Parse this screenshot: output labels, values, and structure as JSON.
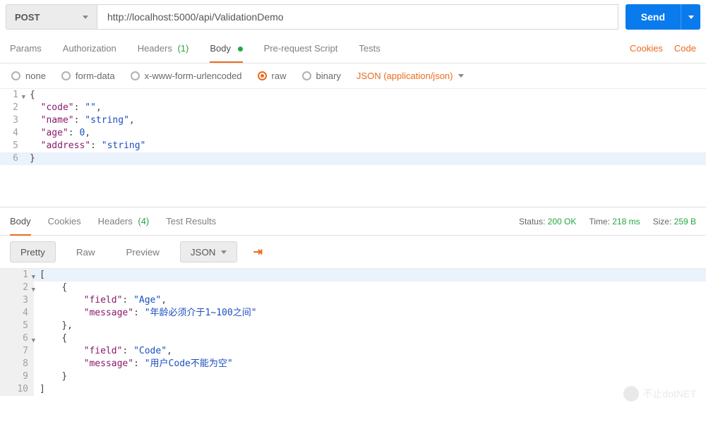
{
  "request": {
    "method": "POST",
    "url": "http://localhost:5000/api/ValidationDemo",
    "send_label": "Send"
  },
  "tabs": {
    "params": "Params",
    "authorization": "Authorization",
    "headers": "Headers",
    "headers_count": "(1)",
    "body": "Body",
    "prerequest": "Pre-request Script",
    "tests": "Tests",
    "cookies_link": "Cookies",
    "code_link": "Code"
  },
  "body_types": {
    "none": "none",
    "form_data": "form-data",
    "urlencoded": "x-www-form-urlencoded",
    "raw": "raw",
    "binary": "binary",
    "content_type": "JSON (application/json)"
  },
  "request_body_lines": [
    {
      "n": "1",
      "html": "<span class='tok-brace'>{</span>",
      "fold": true
    },
    {
      "n": "2",
      "html": "  <span class='tok-key'>\"code\"</span><span class='tok-punct'>: </span><span class='tok-str'>\"\"</span><span class='tok-punct'>,</span>"
    },
    {
      "n": "3",
      "html": "  <span class='tok-key'>\"name\"</span><span class='tok-punct'>: </span><span class='tok-str'>\"string\"</span><span class='tok-punct'>,</span>"
    },
    {
      "n": "4",
      "html": "  <span class='tok-key'>\"age\"</span><span class='tok-punct'>: </span><span class='tok-num'>0</span><span class='tok-punct'>,</span>"
    },
    {
      "n": "5",
      "html": "  <span class='tok-key'>\"address\"</span><span class='tok-punct'>: </span><span class='tok-str'>\"string\"</span>"
    },
    {
      "n": "6",
      "html": "<span class='tok-brace'>}</span>",
      "hl": true
    }
  ],
  "response_tabs": {
    "body": "Body",
    "cookies": "Cookies",
    "headers": "Headers",
    "headers_count": "(4)",
    "test_results": "Test Results"
  },
  "response_meta": {
    "status_label": "Status:",
    "status_value": "200 OK",
    "time_label": "Time:",
    "time_value": "218 ms",
    "size_label": "Size:",
    "size_value": "259 B"
  },
  "response_toolbar": {
    "pretty": "Pretty",
    "raw": "Raw",
    "preview": "Preview",
    "format": "JSON"
  },
  "response_body_lines": [
    {
      "n": "1",
      "html": "<span class='tok-brace'>[</span>",
      "fold": true,
      "hl": true
    },
    {
      "n": "2",
      "html": "    <span class='tok-brace'>{</span>",
      "fold": true
    },
    {
      "n": "3",
      "html": "        <span class='tok-key'>\"field\"</span><span class='tok-punct'>: </span><span class='tok-str'>\"Age\"</span><span class='tok-punct'>,</span>"
    },
    {
      "n": "4",
      "html": "        <span class='tok-key'>\"message\"</span><span class='tok-punct'>: </span><span class='tok-str'>\"年龄必须介于1~100之间\"</span>"
    },
    {
      "n": "5",
      "html": "    <span class='tok-brace'>}</span><span class='tok-punct'>,</span>"
    },
    {
      "n": "6",
      "html": "    <span class='tok-brace'>{</span>",
      "fold": true
    },
    {
      "n": "7",
      "html": "        <span class='tok-key'>\"field\"</span><span class='tok-punct'>: </span><span class='tok-str'>\"Code\"</span><span class='tok-punct'>,</span>"
    },
    {
      "n": "8",
      "html": "        <span class='tok-key'>\"message\"</span><span class='tok-punct'>: </span><span class='tok-str'>\"用户Code不能为空\"</span>"
    },
    {
      "n": "9",
      "html": "    <span class='tok-brace'>}</span>"
    },
    {
      "n": "10",
      "html": "<span class='tok-brace'>]</span>"
    }
  ],
  "watermark": "不止dotNET"
}
